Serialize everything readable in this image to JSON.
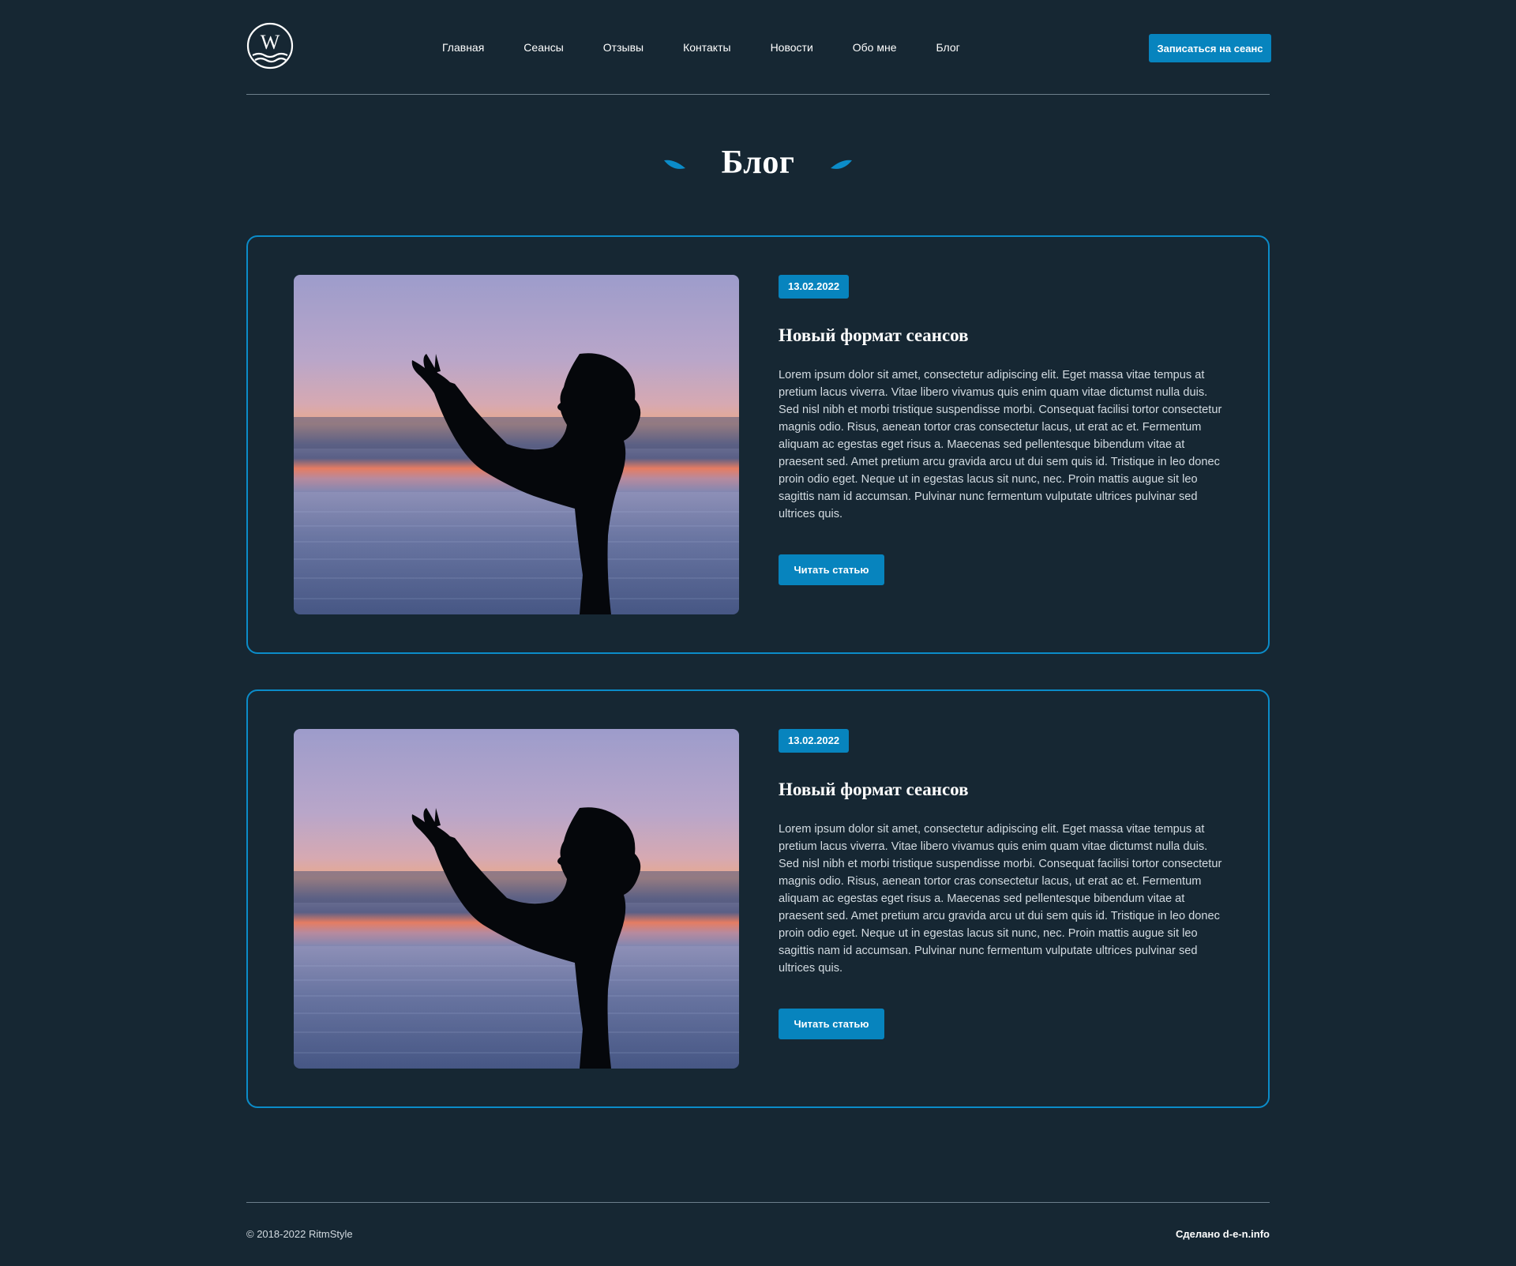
{
  "header": {
    "logo_alt": "W",
    "nav": [
      "Главная",
      "Сеансы",
      "Отзывы",
      "Контакты",
      "Новости",
      "Обо мне",
      "Блог"
    ],
    "cta_label": "Записаться на сеанс"
  },
  "page": {
    "title": "Блог"
  },
  "posts": [
    {
      "date": "13.02.2022",
      "title": "Новый формат сеансов",
      "text": "Lorem ipsum dolor sit amet, consectetur adipiscing elit. Eget massa vitae tempus at pretium lacus viverra. Vitae libero vivamus quis enim quam vitae dictumst nulla duis. Sed nisl nibh et morbi tristique suspendisse morbi. Consequat facilisi tortor consectetur magnis odio. Risus, aenean tortor cras consectetur lacus, ut erat ac et. Fermentum aliquam ac egestas eget risus a. Maecenas sed pellentesque bibendum vitae at praesent sed. Amet pretium arcu gravida arcu ut dui sem quis id. Tristique in leo donec proin odio eget. Neque ut in egestas lacus sit nunc, nec. Proin mattis augue sit leo sagittis nam id accumsan. Pulvinar nunc fermentum vulputate ultrices pulvinar sed ultrices quis.",
      "button": "Читать статью",
      "image": "woman silhouette at sunset by the sea"
    },
    {
      "date": "13.02.2022",
      "title": "Новый формат сеансов",
      "text": "Lorem ipsum dolor sit amet, consectetur adipiscing elit. Eget massa vitae tempus at pretium lacus viverra. Vitae libero vivamus quis enim quam vitae dictumst nulla duis. Sed nisl nibh et morbi tristique suspendisse morbi. Consequat facilisi tortor consectetur magnis odio. Risus, aenean tortor cras consectetur lacus, ut erat ac et. Fermentum aliquam ac egestas eget risus a. Maecenas sed pellentesque bibendum vitae at praesent sed. Amet pretium arcu gravida arcu ut dui sem quis id. Tristique in leo donec proin odio eget. Neque ut in egestas lacus sit nunc, nec. Proin mattis augue sit leo sagittis nam id accumsan. Pulvinar nunc fermentum vulputate ultrices pulvinar sed ultrices quis.",
      "button": "Читать статью",
      "image": "woman silhouette at sunset by the sea"
    }
  ],
  "footer": {
    "copyright": "© 2018-2022 RitmStyle",
    "made_by": "Сделано d-e-n.info"
  },
  "colors": {
    "background": "#162733",
    "accent": "#0784be",
    "card_border": "#0b8cc9",
    "divider": "#6d7f8c"
  }
}
